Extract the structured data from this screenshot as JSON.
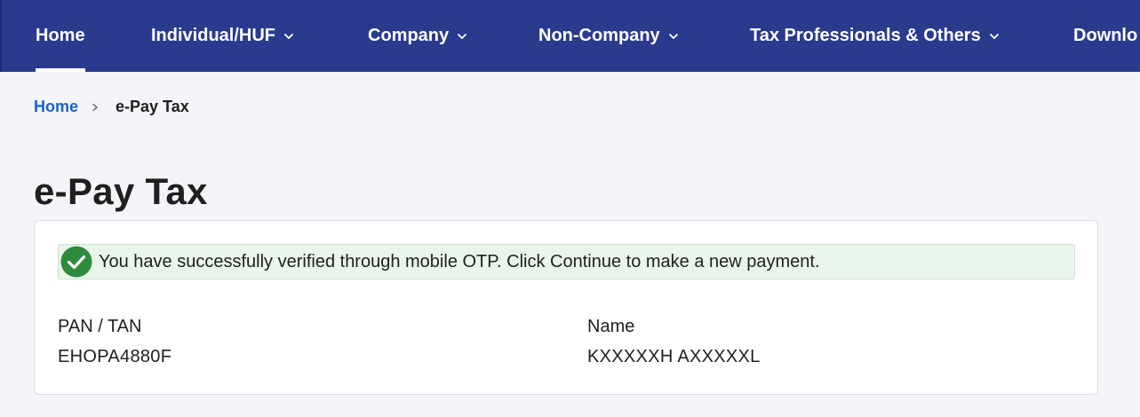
{
  "nav": {
    "items": [
      {
        "label": "Home",
        "active": true
      },
      {
        "label": "Individual/HUF"
      },
      {
        "label": "Company"
      },
      {
        "label": "Non-Company"
      },
      {
        "label": "Tax Professionals & Others"
      },
      {
        "label": "Downlo"
      }
    ],
    "bg_color": "#2a3a8c"
  },
  "breadcrumb": {
    "home": "Home",
    "current": "e-Pay Tax"
  },
  "page": {
    "title": "e-Pay Tax"
  },
  "alert": {
    "message": "You have successfully verified through mobile OTP. Click Continue to make a new payment.",
    "icon": "check-circle-icon",
    "color": "#2e8b3e"
  },
  "details": {
    "pan_label": "PAN / TAN",
    "pan_value": "EHOPA4880F",
    "name_label": "Name",
    "name_value": "KXXXXXH AXXXXXL"
  }
}
